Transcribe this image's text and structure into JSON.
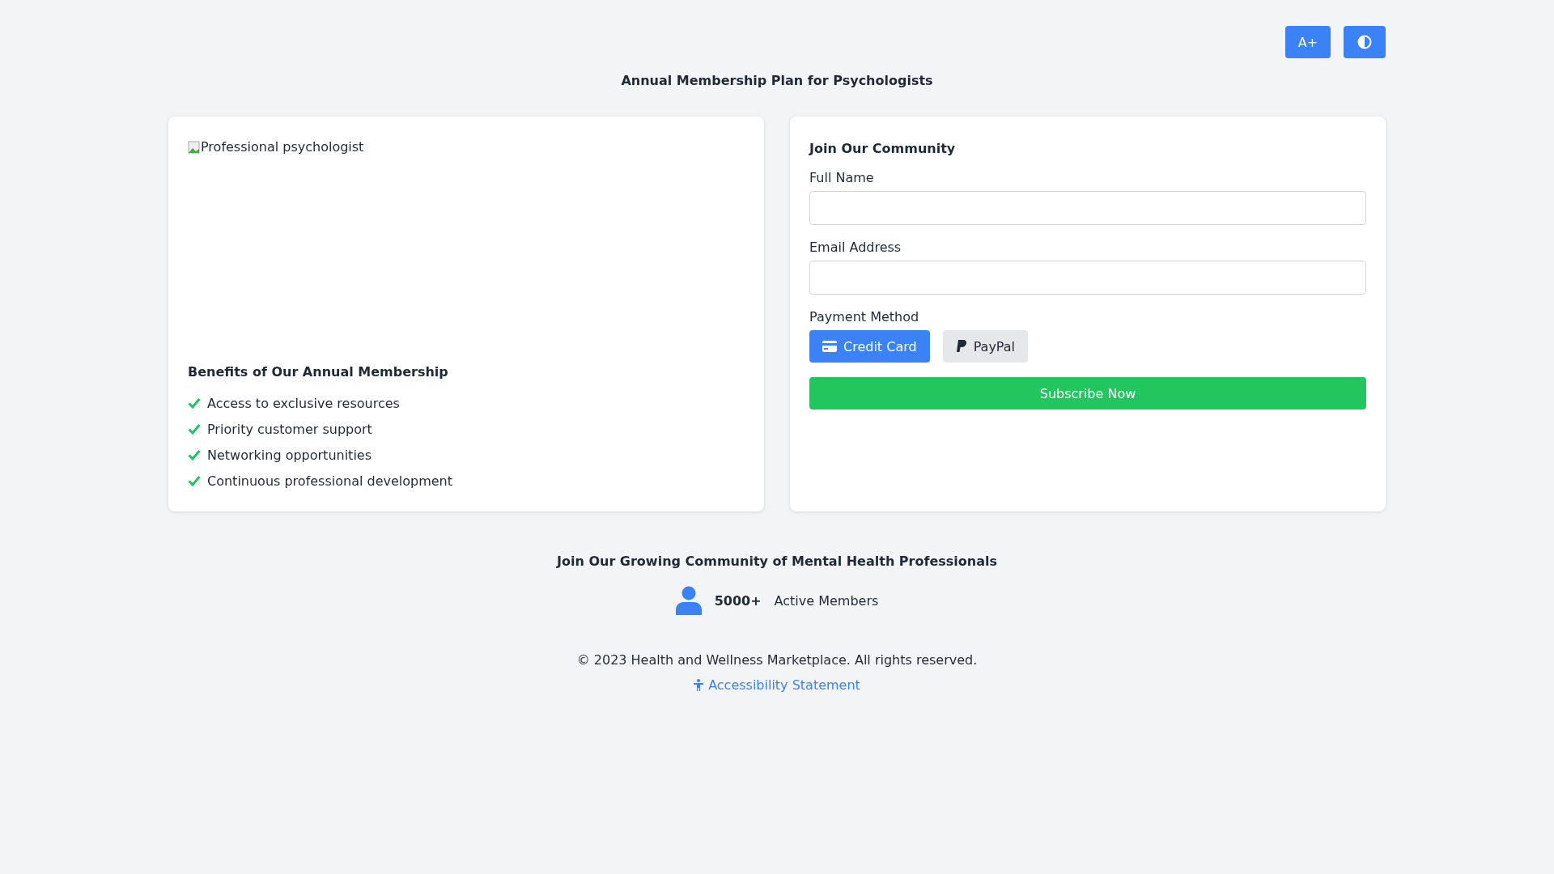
{
  "toolbar": {
    "font_button": "A+"
  },
  "title": "Annual Membership Plan for Psychologists",
  "image": {
    "alt": "Professional psychologist"
  },
  "benefits": {
    "heading": "Benefits of Our Annual Membership",
    "items": [
      "Access to exclusive resources",
      "Priority customer support",
      "Networking opportunities",
      "Continuous professional development"
    ]
  },
  "form": {
    "heading": "Join Our Community",
    "fields": [
      {
        "label": "Full Name"
      },
      {
        "label": "Email Address"
      }
    ],
    "payment_label": "Payment Method",
    "payment_methods": [
      {
        "kind": "card",
        "label": "Credit Card",
        "selected": true
      },
      {
        "kind": "paypal",
        "label": "PayPal",
        "selected": false
      }
    ],
    "submit": "Subscribe Now"
  },
  "community": {
    "heading": "Join Our Growing Community of Mental Health Professionals",
    "count": "5000+",
    "count_label": "Active Members"
  },
  "footer": {
    "copyright": "© 2023 Health and Wellness Marketplace. All rights reserved.",
    "link": "Accessibility Statement"
  }
}
